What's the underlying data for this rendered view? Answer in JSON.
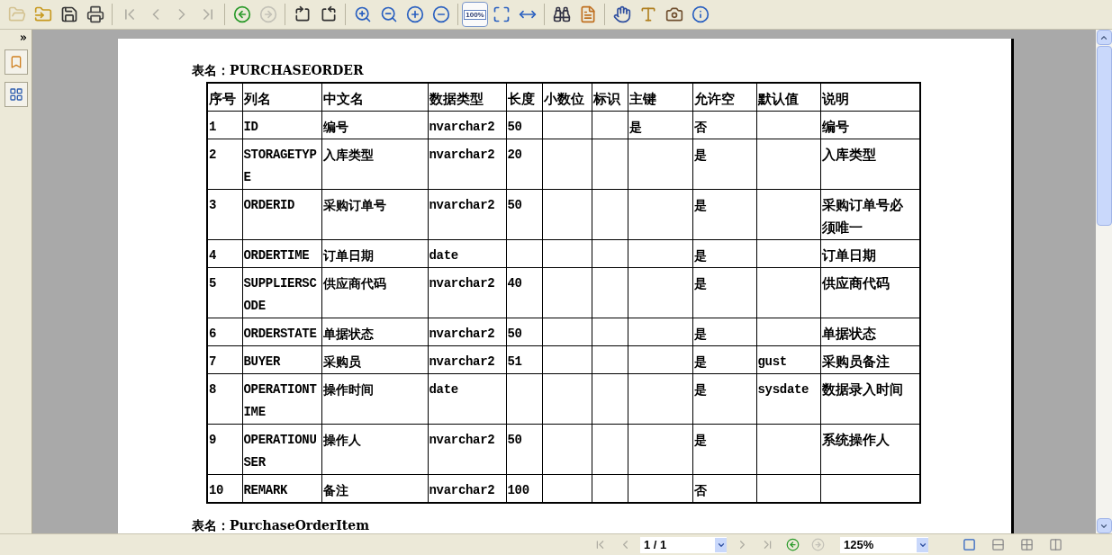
{
  "toolbar": [
    {
      "kind": "open",
      "selected": false,
      "disabled": true
    },
    {
      "kind": "open-folder",
      "selected": false,
      "disabled": false
    },
    {
      "kind": "save",
      "selected": false,
      "disabled": false
    },
    {
      "kind": "print",
      "selected": false,
      "disabled": false
    },
    {
      "kind": "sep"
    },
    {
      "kind": "first",
      "selected": false,
      "disabled": true
    },
    {
      "kind": "prev",
      "selected": false,
      "disabled": true
    },
    {
      "kind": "next",
      "selected": false,
      "disabled": true
    },
    {
      "kind": "last",
      "selected": false,
      "disabled": true
    },
    {
      "kind": "sep"
    },
    {
      "kind": "back",
      "selected": false,
      "disabled": false
    },
    {
      "kind": "forward",
      "selected": false,
      "disabled": true
    },
    {
      "kind": "sep"
    },
    {
      "kind": "rotate-cw",
      "selected": false,
      "disabled": false
    },
    {
      "kind": "rotate-ccw",
      "selected": false,
      "disabled": false
    },
    {
      "kind": "sep"
    },
    {
      "kind": "zoom-in",
      "selected": false,
      "disabled": false
    },
    {
      "kind": "zoom-out",
      "selected": false,
      "disabled": false
    },
    {
      "kind": "plus",
      "selected": false,
      "disabled": false
    },
    {
      "kind": "minus",
      "selected": false,
      "disabled": false
    },
    {
      "kind": "sep"
    },
    {
      "kind": "actual-size",
      "label": "100%",
      "selected": true,
      "disabled": false
    },
    {
      "kind": "fit-page",
      "selected": false,
      "disabled": false
    },
    {
      "kind": "fit-width",
      "selected": false,
      "disabled": false
    },
    {
      "kind": "sep"
    },
    {
      "kind": "find",
      "selected": false,
      "disabled": false
    },
    {
      "kind": "bookmark",
      "selected": false,
      "disabled": false
    },
    {
      "kind": "sep"
    },
    {
      "kind": "hand",
      "selected": false,
      "disabled": false
    },
    {
      "kind": "text",
      "selected": false,
      "disabled": false
    },
    {
      "kind": "snapshot",
      "selected": false,
      "disabled": false
    },
    {
      "kind": "info",
      "selected": false,
      "disabled": false
    }
  ],
  "side_panel": [
    {
      "kind": "bookmarks",
      "selected": false
    },
    {
      "kind": "thumbnails",
      "selected": false
    }
  ],
  "document": {
    "title": "表名：PURCHASEORDER",
    "table": {
      "columns": [
        "序号",
        "列名",
        "中文名",
        "数据类型",
        "长度",
        "小数位",
        "标识",
        "主键",
        "允许空",
        "默认值",
        "说明"
      ],
      "rows": [
        [
          "1",
          "ID",
          "编号",
          "nvarchar2",
          "50",
          "",
          "",
          "是",
          "否",
          "",
          "编号"
        ],
        [
          "2",
          "STORAGETYPE",
          "入库类型",
          "nvarchar2",
          "20",
          "",
          "",
          "",
          "是",
          "",
          "入库类型"
        ],
        [
          "3",
          "ORDERID",
          "采购订单号",
          "nvarchar2",
          "50",
          "",
          "",
          "",
          "是",
          "",
          "采购订单号必须唯一"
        ],
        [
          "4",
          "ORDERTIME",
          "订单日期",
          "date",
          "",
          "",
          "",
          "",
          "是",
          "",
          "订单日期"
        ],
        [
          "5",
          "SUPPLIERSCODE",
          "供应商代码",
          "nvarchar2",
          "40",
          "",
          "",
          "",
          "是",
          "",
          "供应商代码"
        ],
        [
          "6",
          "ORDERSTATE",
          "单据状态",
          "nvarchar2",
          "50",
          "",
          "",
          "",
          "是",
          "",
          "单据状态"
        ],
        [
          "7",
          "BUYER",
          "采购员",
          "nvarchar2",
          "51",
          "",
          "",
          "",
          "是",
          "gust",
          "采购员备注"
        ],
        [
          "8",
          "OPERATIONTIME",
          "操作时间",
          "date",
          "",
          "",
          "",
          "",
          "是",
          "sysdate",
          "数据录入时间"
        ],
        [
          "9",
          "OPERATIONUSER",
          "操作人",
          "nvarchar2",
          "50",
          "",
          "",
          "",
          "是",
          "",
          "系统操作人"
        ],
        [
          "10",
          "REMARK",
          "备注",
          "nvarchar2",
          "100",
          "",
          "",
          "",
          "否",
          "",
          ""
        ]
      ]
    },
    "next_title": "表名：PurchaseOrderItem"
  },
  "status_bar": {
    "page": "1 / 1",
    "zoom": "125%",
    "nav": [
      {
        "kind": "first",
        "disabled": true
      },
      {
        "kind": "prev",
        "disabled": true
      },
      {
        "kind": "page"
      },
      {
        "kind": "next",
        "disabled": true
      },
      {
        "kind": "last",
        "disabled": true
      },
      {
        "kind": "back",
        "disabled": false
      },
      {
        "kind": "forward",
        "disabled": true
      },
      {
        "kind": "zoom"
      }
    ],
    "views": [
      {
        "kind": "single",
        "selected": true
      },
      {
        "kind": "continuous",
        "selected": false
      },
      {
        "kind": "facing-continuous",
        "selected": false
      },
      {
        "kind": "facing",
        "selected": false
      }
    ]
  }
}
